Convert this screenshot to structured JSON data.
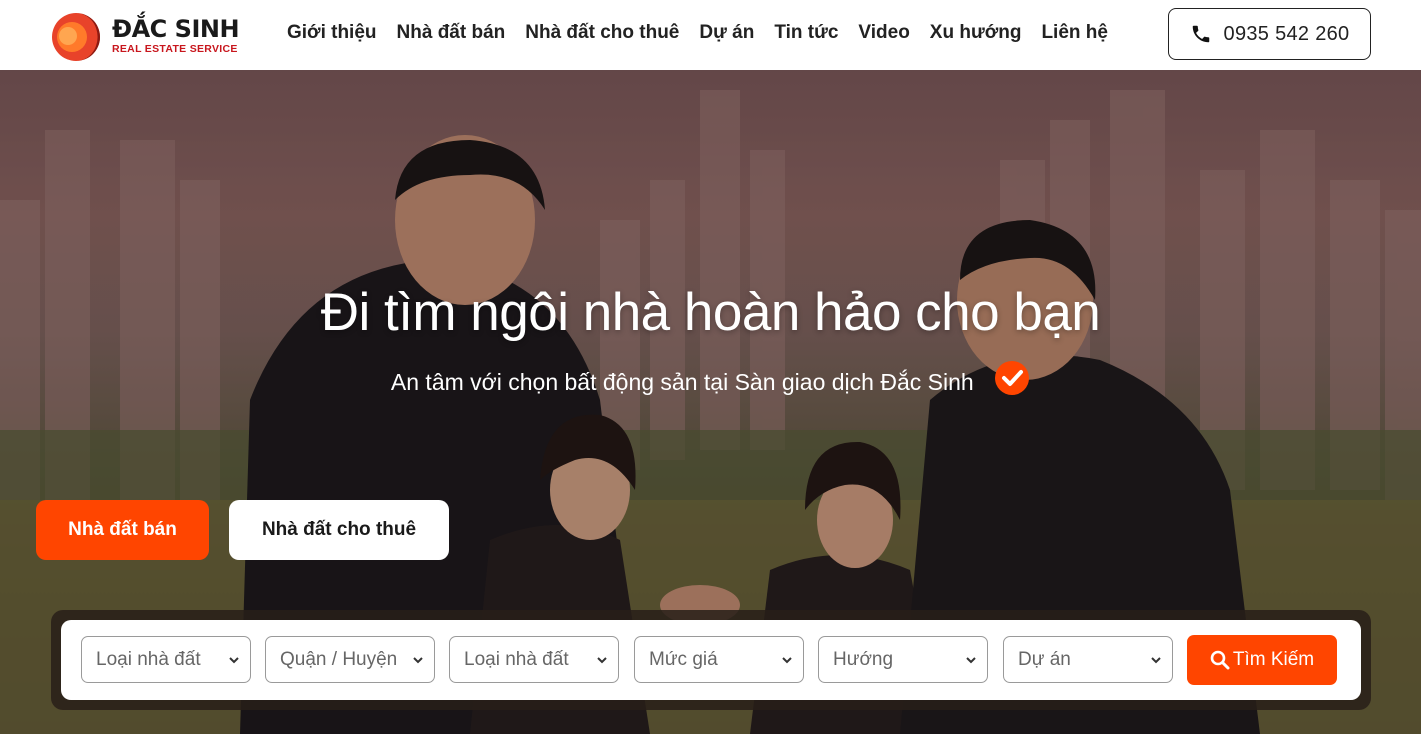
{
  "brand": {
    "name": "ĐẮC SINH",
    "tagline": "REAL ESTATE SERVICE",
    "accent": "#ff4500",
    "brand_red": "#c8161d"
  },
  "nav": {
    "items": [
      {
        "label": "Giới thiệu"
      },
      {
        "label": "Nhà đất bán"
      },
      {
        "label": "Nhà đất cho thuê"
      },
      {
        "label": "Dự án"
      },
      {
        "label": "Tin tức"
      },
      {
        "label": "Video"
      },
      {
        "label": "Xu hướng"
      },
      {
        "label": "Liên hệ"
      }
    ],
    "phone": "0935 542 260",
    "phone_icon": "phone-icon"
  },
  "hero": {
    "title": "Đi tìm ngôi nhà hoàn hảo cho bạn",
    "subtitle": "An tâm với chọn bất động sản tại Sàn giao dịch Đắc Sinh",
    "subtitle_icon": "check-circle-icon",
    "tabs": [
      {
        "label": "Nhà đất bán",
        "active": true
      },
      {
        "label": "Nhà đất cho thuê",
        "active": false
      }
    ]
  },
  "search": {
    "selects": [
      {
        "value": "Loại nhà đất"
      },
      {
        "value": "Quận / Huyện"
      },
      {
        "value": "Loại nhà đất"
      },
      {
        "value": "Mức giá"
      },
      {
        "value": "Hướng"
      },
      {
        "value": "Dự án"
      }
    ],
    "button_label": "Tìm Kiếm",
    "button_icon": "search-icon"
  }
}
